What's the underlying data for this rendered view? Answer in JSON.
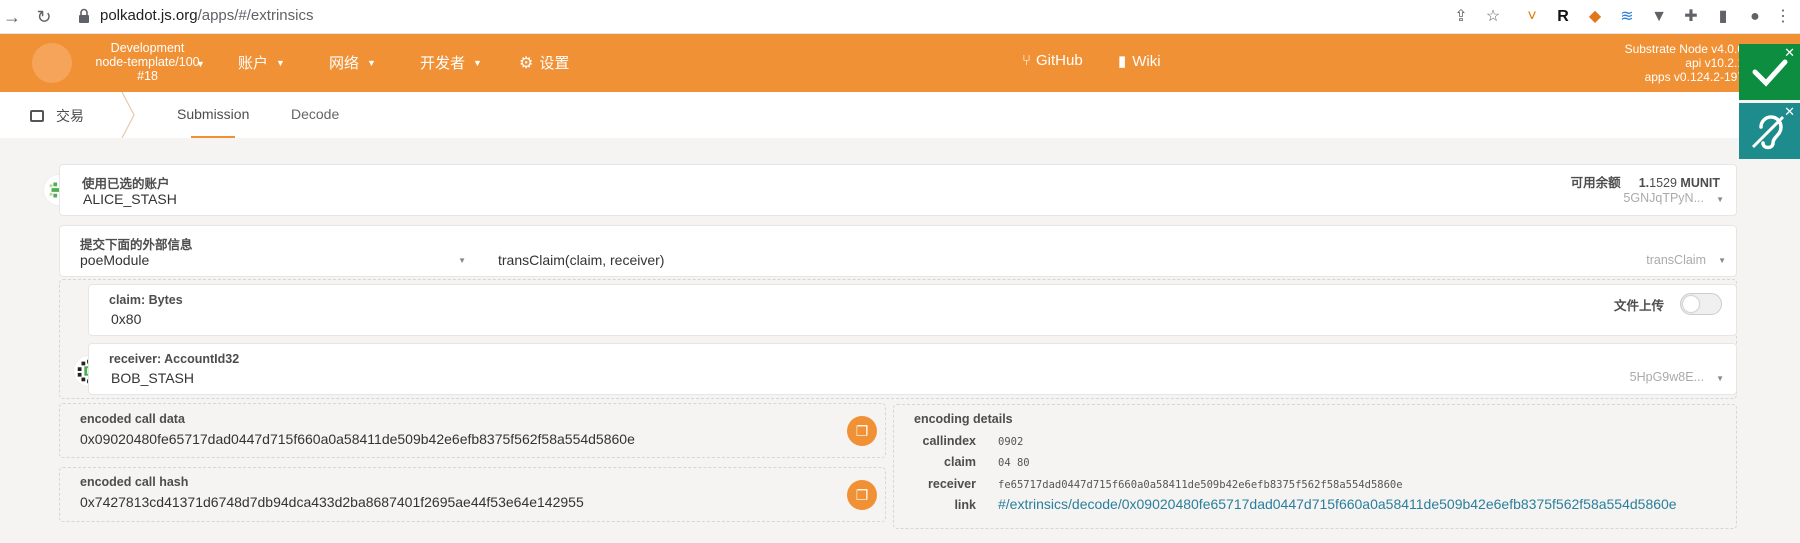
{
  "browser": {
    "url_host": "polkadot.js.org",
    "url_path": "/apps/#/extrinsics"
  },
  "topbar": {
    "chain": {
      "name": "Development",
      "node": "node-template/100",
      "block": "#18"
    },
    "menu": [
      {
        "label": "账户"
      },
      {
        "label": "网络"
      },
      {
        "label": "开发者"
      },
      {
        "label": "设置"
      }
    ],
    "links": [
      {
        "label": "GitHub"
      },
      {
        "label": "Wiki"
      }
    ],
    "version": {
      "node": "Substrate Node v4.0.0",
      "api": "api v10.2.1",
      "apps": "apps v0.124.2-197"
    }
  },
  "subnav": {
    "section": "交易",
    "tabs": [
      {
        "label": "Submission"
      },
      {
        "label": "Decode"
      }
    ]
  },
  "account": {
    "label": "使用已选的账户",
    "value": "ALICE_STASH",
    "balance_label": "可用余额",
    "balance_int": "1.",
    "balance_dec": "1529",
    "balance_unit": "MUNIT",
    "address": "5GNJqTPyN..."
  },
  "extrinsic": {
    "label": "提交下面的外部信息",
    "module": "poeModule",
    "call": "transClaim(claim, receiver)",
    "call_short": "transClaim"
  },
  "params": {
    "claim": {
      "label": "claim: Bytes",
      "value": "0x80",
      "upload_label": "文件上传"
    },
    "receiver": {
      "label": "receiver: AccountId32",
      "value": "BOB_STASH",
      "address": "5HpG9w8E..."
    }
  },
  "encoded": {
    "call_data_label": "encoded call data",
    "call_data": "0x09020480fe65717dad0447d715f660a0a58411de509b42e6efb8375f562f58a554d5860e",
    "call_hash_label": "encoded call hash",
    "call_hash": "0x7427813cd41371d6748d7db94dca433d2ba8687401f2695ae44f53e64e142955"
  },
  "encoding_details": {
    "title": "encoding details",
    "callindex_label": "callindex",
    "callindex": "0902",
    "claim_label": "claim",
    "claim": "04 80",
    "receiver_label": "receiver",
    "receiver": "fe65717dad0447d715f660a0a58411de509b42e6efb8375f562f58a554d5860e",
    "link_label": "link",
    "link": "#/extrinsics/decode/0x09020480fe65717dad0447d715f660a0a58411de509b42e6efb8375f562f58a554d5860e"
  },
  "colors": {
    "accent": "#f19135",
    "badge_green": "#0c8d3f",
    "badge_teal": "#1e8c8c",
    "link": "#2a7f9b"
  }
}
